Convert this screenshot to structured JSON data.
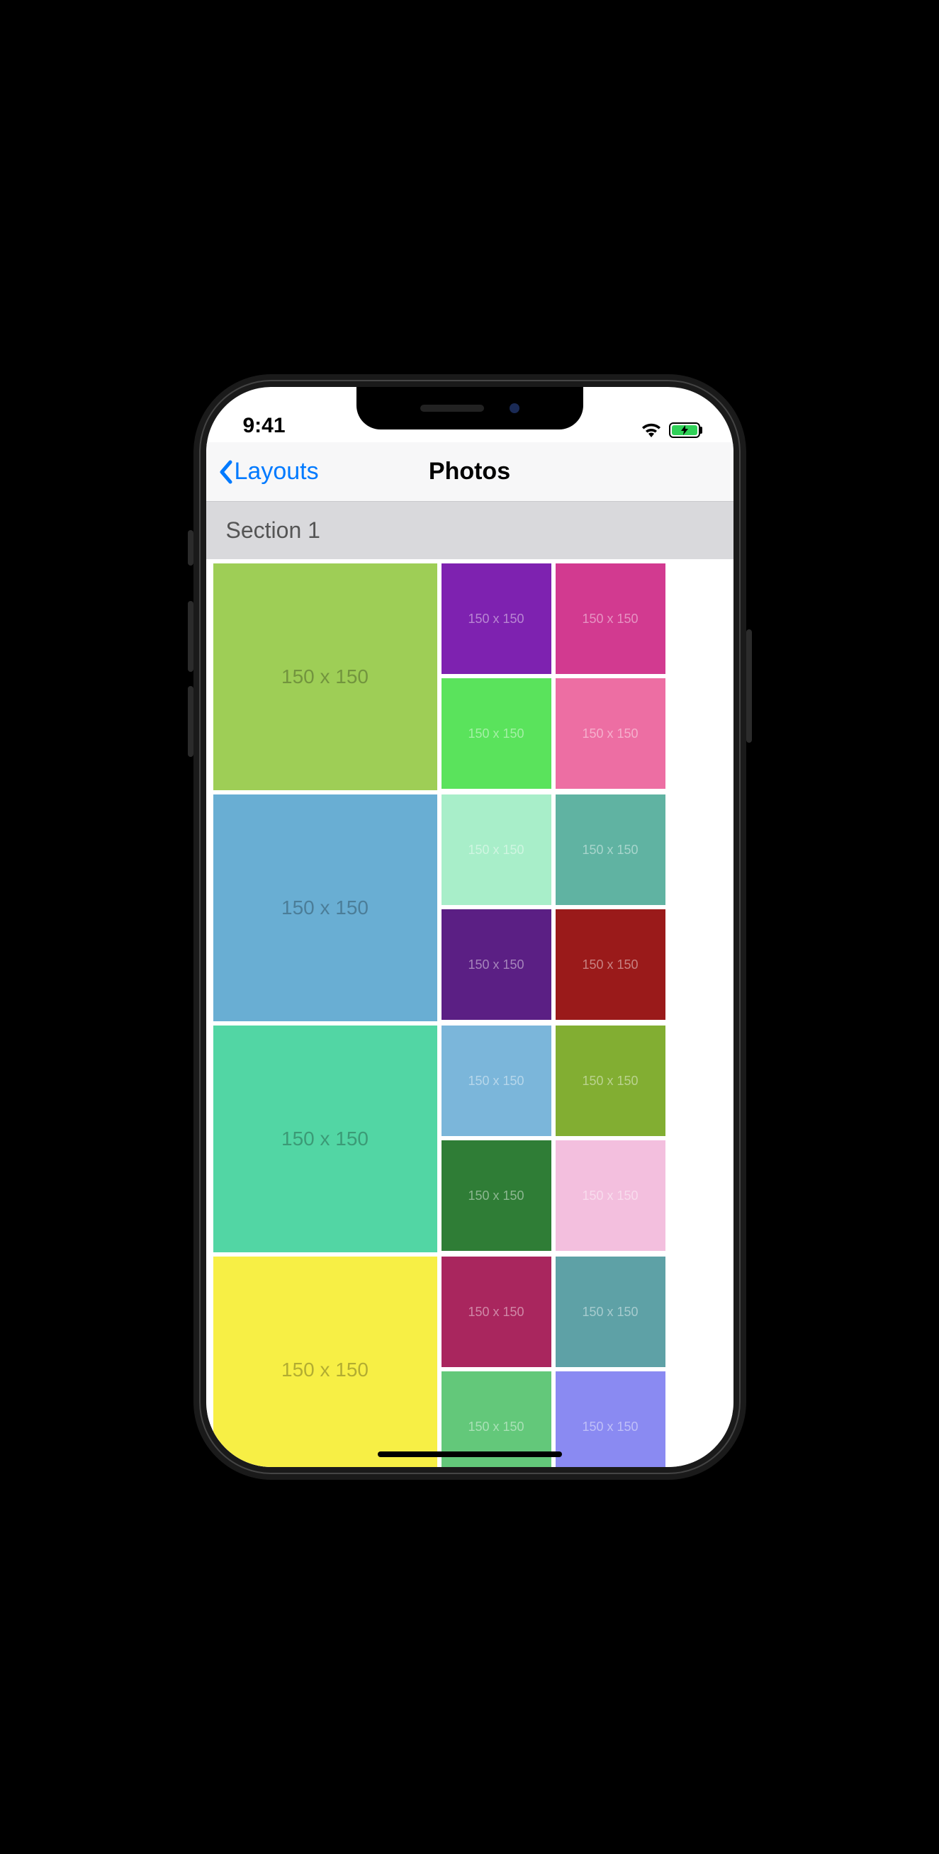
{
  "status": {
    "time": "9:41",
    "wifi": "wifi-icon",
    "battery_charging": true
  },
  "nav": {
    "back_label": "Layouts",
    "title": "Photos"
  },
  "section": {
    "header": "Section 1"
  },
  "placeholder_label": "150 x 150",
  "blocks": [
    {
      "large": {
        "color": "#9ece56"
      },
      "small": [
        {
          "color": "#7e22b0"
        },
        {
          "color": "#d23a90"
        },
        {
          "color": "#5ae35c"
        },
        {
          "color": "#ed6ea3"
        }
      ]
    },
    {
      "large": {
        "color": "#69aed3"
      },
      "small": [
        {
          "color": "#a8eec9"
        },
        {
          "color": "#60b3a2"
        },
        {
          "color": "#5b1f84"
        },
        {
          "color": "#9a1a1a"
        }
      ]
    },
    {
      "large": {
        "color": "#52d6a4"
      },
      "small": [
        {
          "color": "#7bb6da"
        },
        {
          "color": "#82ae32"
        },
        {
          "color": "#2f7d36"
        },
        {
          "color": "#f3bfde"
        }
      ]
    },
    {
      "large": {
        "color": "#f7ef45"
      },
      "small": [
        {
          "color": "#a9265e"
        },
        {
          "color": "#5ea1a6"
        },
        {
          "color": "#63c87a"
        },
        {
          "color": "#8a8af2"
        }
      ]
    }
  ]
}
